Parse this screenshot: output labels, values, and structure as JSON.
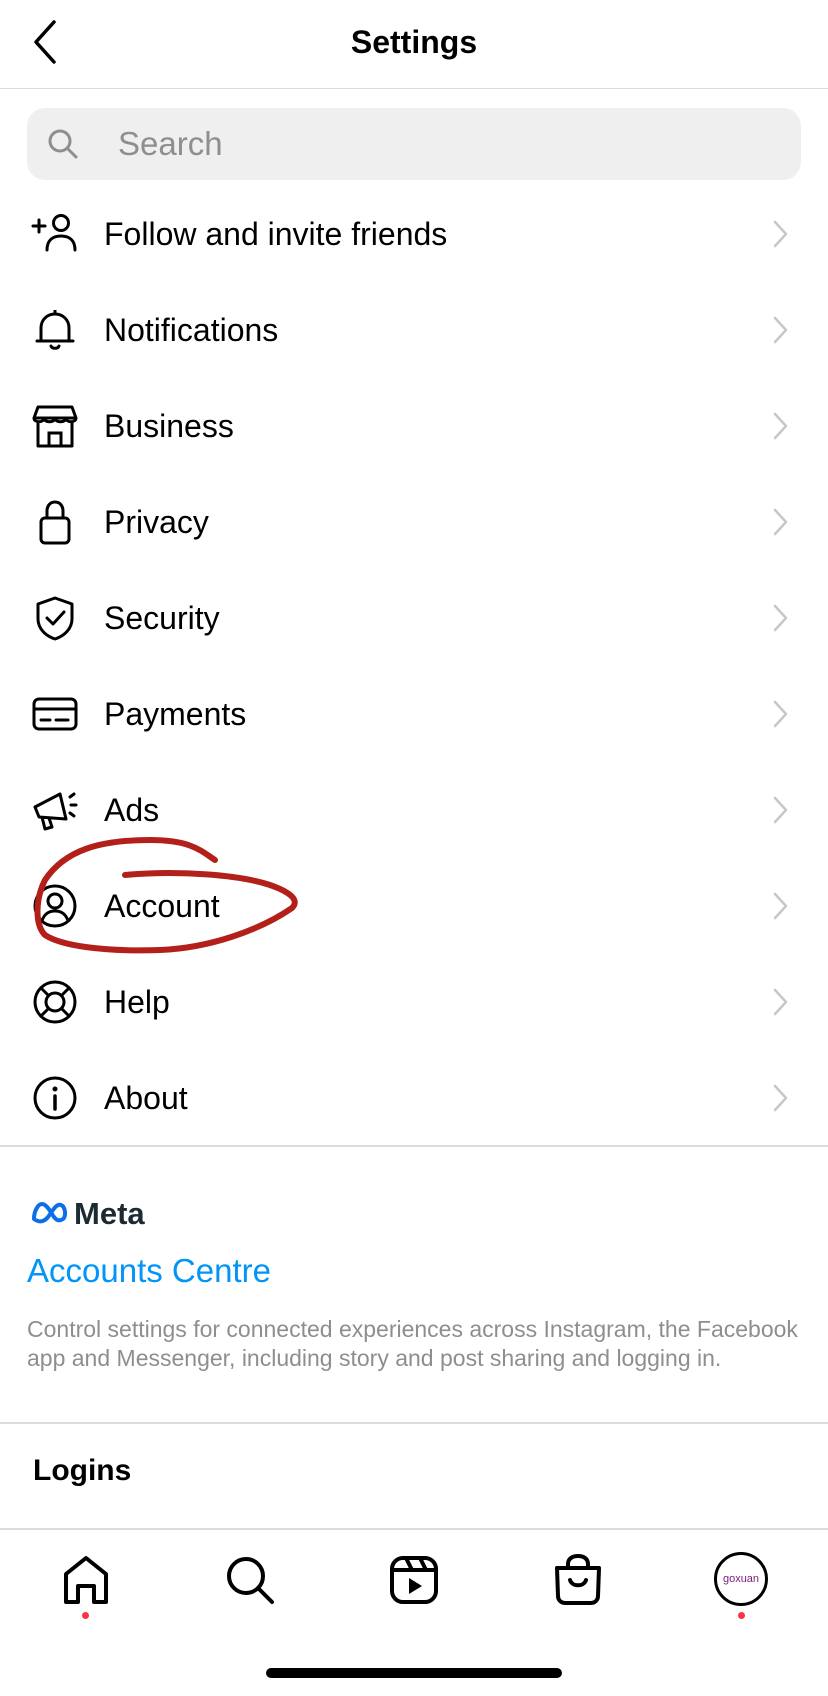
{
  "header": {
    "title": "Settings"
  },
  "search": {
    "placeholder": "Search"
  },
  "menu": {
    "items": [
      {
        "label": "Follow and invite friends",
        "icon": "add-person-icon"
      },
      {
        "label": "Notifications",
        "icon": "bell-icon"
      },
      {
        "label": "Business",
        "icon": "shop-icon"
      },
      {
        "label": "Privacy",
        "icon": "lock-icon"
      },
      {
        "label": "Security",
        "icon": "shield-icon"
      },
      {
        "label": "Payments",
        "icon": "card-icon"
      },
      {
        "label": "Ads",
        "icon": "megaphone-icon"
      },
      {
        "label": "Account",
        "icon": "account-circle-icon"
      },
      {
        "label": "Help",
        "icon": "lifebuoy-icon"
      },
      {
        "label": "About",
        "icon": "info-icon"
      }
    ]
  },
  "meta": {
    "brand": "Meta",
    "accounts_centre": "Accounts Centre",
    "description": "Control settings for connected experiences across Instagram, the Facebook app and Messenger, including story and post sharing and logging in."
  },
  "logins": {
    "title": "Logins"
  },
  "tabbar": {
    "tabs": [
      "home",
      "search",
      "reels",
      "shop",
      "profile"
    ],
    "avatar_text": "goxuan"
  },
  "colors": {
    "link": "#0095f6",
    "annotation": "#b3201a",
    "notification_dot": "#ff3040"
  }
}
